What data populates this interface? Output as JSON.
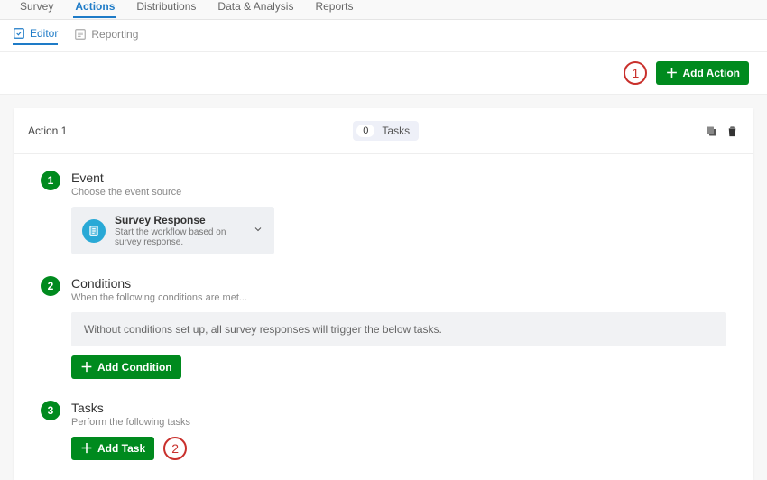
{
  "topnav": {
    "items": [
      "Survey",
      "Actions",
      "Distributions",
      "Data & Analysis",
      "Reports"
    ],
    "activeIndex": 1
  },
  "subnav": {
    "items": [
      "Editor",
      "Reporting"
    ],
    "activeIndex": 0
  },
  "toolbar": {
    "addActionLabel": "Add Action",
    "callout1": "1"
  },
  "action": {
    "title": "Action 1",
    "tasksCount": "0",
    "tasksLabel": "Tasks"
  },
  "steps": {
    "event": {
      "num": "1",
      "title": "Event",
      "sub": "Choose the event source",
      "selectTitle": "Survey Response",
      "selectDesc": "Start the workflow based on survey response."
    },
    "conditions": {
      "num": "2",
      "title": "Conditions",
      "sub": "When the following conditions are met...",
      "banner": "Without conditions set up, all survey responses will trigger the below tasks.",
      "addLabel": "Add Condition"
    },
    "tasks": {
      "num": "3",
      "title": "Tasks",
      "sub": "Perform the following tasks",
      "addLabel": "Add Task",
      "callout2": "2"
    }
  }
}
